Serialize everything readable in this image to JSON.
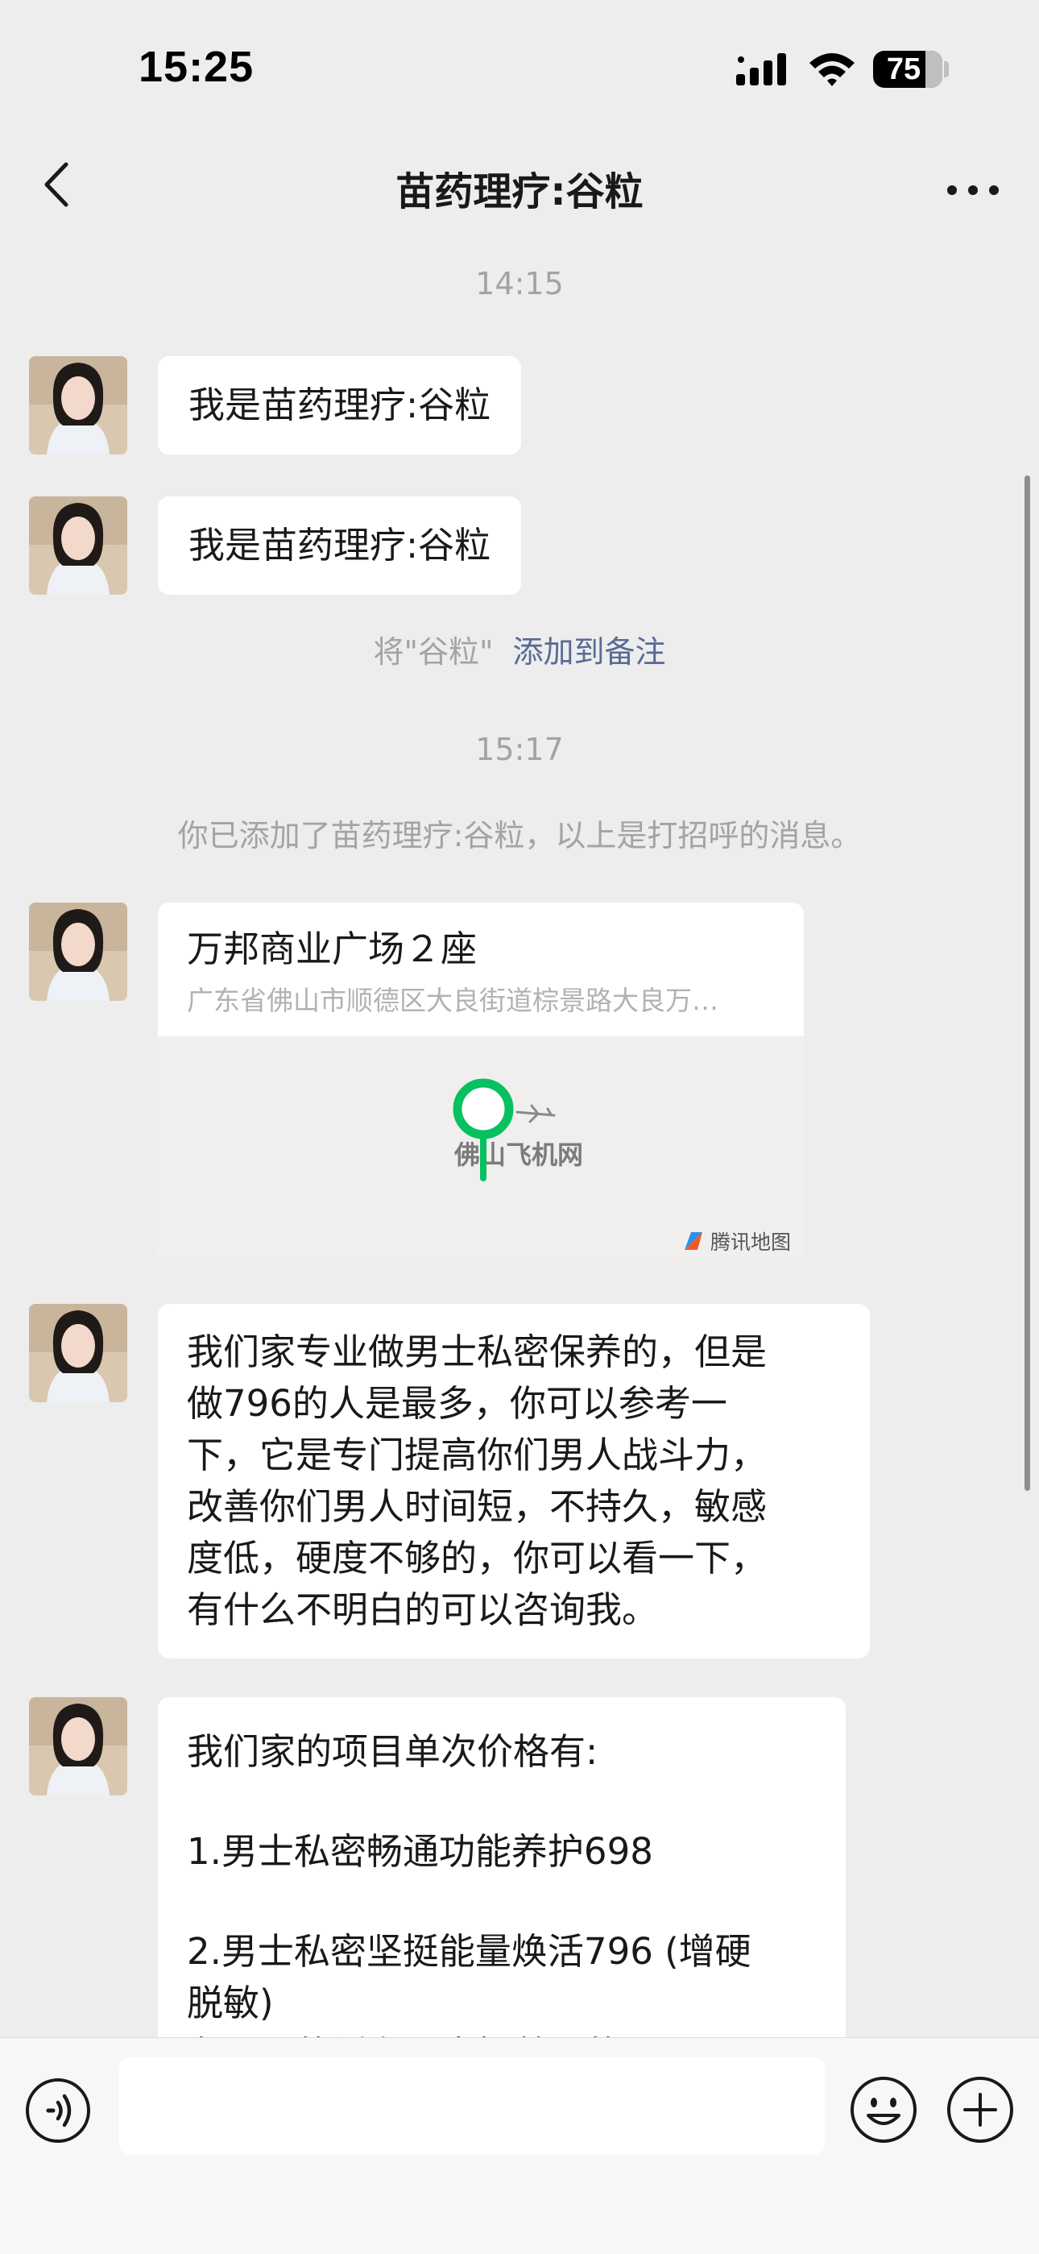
{
  "status_bar": {
    "time": "15:25",
    "battery_percent": "75",
    "battery_level": 0.75,
    "icons": [
      "signal-icon",
      "wifi-icon",
      "battery-icon"
    ]
  },
  "nav": {
    "title": "苗药理疗:谷粒",
    "back_icon": "chevron-left-icon",
    "more_icon": "more-dots-icon"
  },
  "chat": {
    "time_dividers": [
      "14:15",
      "15:17"
    ],
    "messages": [
      {
        "type": "text",
        "lines": [
          "我是苗药理疗:谷粒"
        ]
      },
      {
        "type": "text",
        "lines": [
          "我是苗药理疗:谷粒"
        ]
      },
      {
        "type": "location",
        "name": "万邦商业广场２座",
        "address": "广东省佛山市顺德区大良街道棕景路大良万…",
        "map_label": "佛山飞机网",
        "map_brand": "腾讯地图"
      },
      {
        "type": "text",
        "lines": [
          "我们家专业做男士私密保养的，但是",
          "做796的人是最多，你可以参考一",
          "下，它是专门提高你们男人战斗力，",
          "改善你们男人时间短，不持久，敏感",
          "度低，硬度不够的，你可以看一下，",
          "有什么不明白的可以咨询我。"
        ]
      },
      {
        "type": "text",
        "lines": [
          "我们家的项目单次价格有:",
          "",
          "1.男士私密畅通功能养护698",
          "",
          "2.男士私密坚挺能量焕活796 (增硬",
          "脱敏)",
          "备用下的活在还失提着明的 😊"
        ]
      }
    ],
    "system_notes": {
      "remark_prefix": "将\"谷粒\"",
      "remark_link": "添加到备注",
      "added_notice": "你已添加了苗药理疗:谷粒，以上是打招呼的消息。"
    }
  },
  "input_bar": {
    "value": "",
    "placeholder": "",
    "voice_icon": "voice-icon",
    "emoji_icon": "emoji-icon",
    "plus_icon": "plus-icon"
  },
  "colors": {
    "background": "#ededed",
    "bubble": "#ffffff",
    "link": "#576b95",
    "muted": "#a3a3a3",
    "pin_green": "#07c160"
  }
}
